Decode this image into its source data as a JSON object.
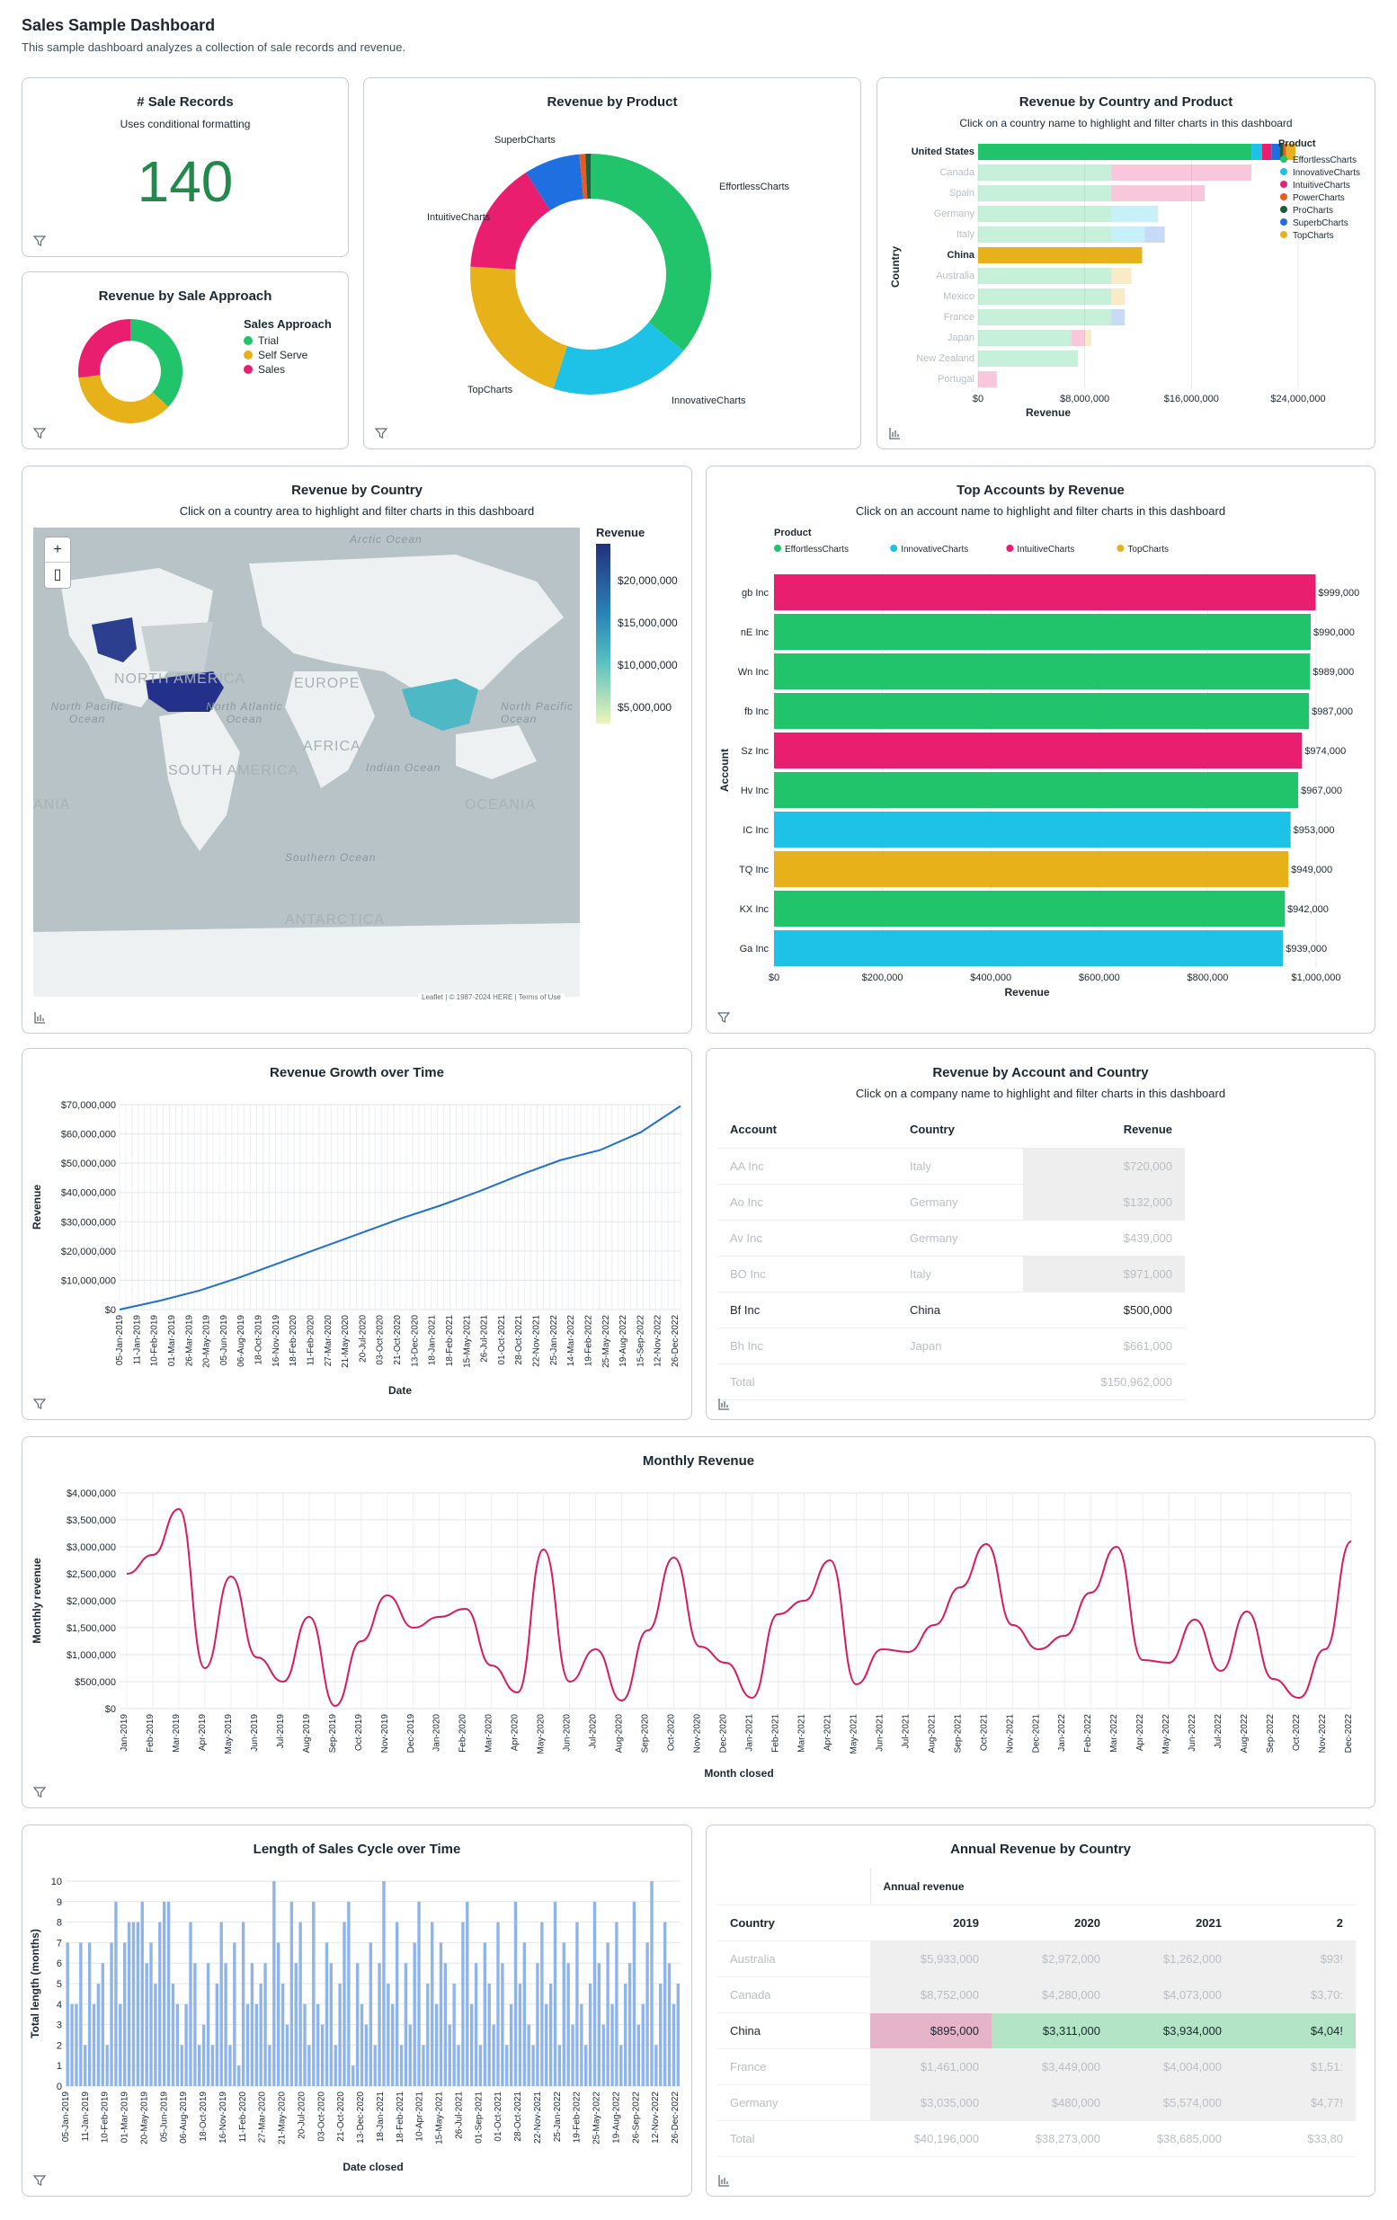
{
  "header": {
    "title": "Sales Sample Dashboard",
    "subtitle": "This sample dashboard analyzes a collection of sale records and revenue."
  },
  "sale_records": {
    "title": "# Sale Records",
    "subtitle": "Uses conditional formatting",
    "value": "140"
  },
  "sale_approach": {
    "title": "Revenue by Sale Approach",
    "legend_title": "Sales Approach",
    "items": [
      {
        "label": "Trial",
        "color": "#21c36b"
      },
      {
        "label": "Self Serve",
        "color": "#e7b119"
      },
      {
        "label": "Sales",
        "color": "#e91e6e"
      }
    ],
    "chart_data": {
      "type": "pie",
      "categories": [
        "Trial",
        "Self Serve",
        "Sales"
      ],
      "values": [
        37,
        36,
        27
      ]
    }
  },
  "rev_product": {
    "title": "Revenue by Product",
    "chart_data": {
      "type": "pie",
      "categories": [
        "EffortlessCharts",
        "InnovativeCharts",
        "TopCharts",
        "IntuitiveCharts",
        "SuperbCharts",
        "PowerCharts",
        "ProCharts"
      ],
      "values": [
        36,
        19,
        21,
        15,
        7.5,
        0.8,
        0.7
      ],
      "colors": [
        "#21c36b",
        "#1ec2e6",
        "#e7b119",
        "#e91e6e",
        "#1f6fe0",
        "#ea5a20",
        "#1b5e3a"
      ]
    }
  },
  "rev_country_product": {
    "title": "Revenue by Country and Product",
    "subtitle": "Click on a country name to highlight and filter charts in this dashboard",
    "ylabel": "Country",
    "xlabel": "Revenue",
    "legend_title": "Product",
    "legend": [
      {
        "label": "EffortlessCharts",
        "color": "#21c36b"
      },
      {
        "label": "InnovativeCharts",
        "color": "#1ec2e6"
      },
      {
        "label": "IntuitiveCharts",
        "color": "#e91e6e"
      },
      {
        "label": "PowerCharts",
        "color": "#ea5a20"
      },
      {
        "label": "ProCharts",
        "color": "#1b5e3a"
      },
      {
        "label": "SuperbCharts",
        "color": "#1f6fe0"
      },
      {
        "label": "TopCharts",
        "color": "#e7b119"
      }
    ],
    "chart_data": {
      "type": "bar",
      "categories": [
        "United States",
        "Canada",
        "Spain",
        "Germany",
        "Italy",
        "China",
        "Australia",
        "Mexico",
        "France",
        "Japan",
        "New Zealand",
        "Portugal"
      ],
      "highlighted": [
        "United States",
        "China"
      ],
      "xticks": [
        "$0",
        "$8,000,000",
        "$16,000,000",
        "$24,000,000"
      ],
      "xlim": [
        0,
        24000000
      ],
      "series": [
        {
          "name": "EffortlessCharts",
          "values": [
            20500000,
            10000000,
            10000000,
            10000000,
            10000000,
            0,
            10000000,
            10000000,
            10000000,
            7000000,
            7500000,
            0
          ]
        },
        {
          "name": "InnovativeCharts",
          "values": [
            800000,
            0,
            0,
            3500000,
            2500000,
            0,
            0,
            0,
            0,
            0,
            0,
            0
          ]
        },
        {
          "name": "IntuitiveCharts",
          "values": [
            700000,
            10500000,
            7000000,
            0,
            0,
            0,
            0,
            0,
            0,
            1000000,
            0,
            1400000
          ]
        },
        {
          "name": "SuperbCharts",
          "values": [
            600000,
            0,
            0,
            0,
            1500000,
            0,
            0,
            0,
            1000000,
            0,
            0,
            0
          ]
        },
        {
          "name": "ProCharts",
          "values": [
            300000,
            0,
            0,
            0,
            0,
            0,
            0,
            0,
            0,
            0,
            0,
            0
          ]
        },
        {
          "name": "PowerCharts",
          "values": [
            200000,
            0,
            0,
            0,
            0,
            0,
            0,
            0,
            0,
            0,
            0,
            0
          ]
        },
        {
          "name": "TopCharts",
          "values": [
            700000,
            0,
            0,
            0,
            0,
            12300000,
            1500000,
            1000000,
            0,
            500000,
            0,
            0
          ]
        }
      ]
    }
  },
  "rev_country": {
    "title": "Revenue by Country",
    "subtitle": "Click on a country area to highlight and filter charts in this dashboard",
    "legend_title": "Revenue",
    "legend_ticks": [
      "$20,000,000",
      "$15,000,000",
      "$10,000,000",
      "$5,000,000"
    ],
    "zoom_in": "+",
    "oceans": [
      "Arctic Ocean",
      "North Pacific Ocean",
      "North Atlantic Ocean",
      "Indian Ocean",
      "North Pacific Ocean",
      "Southern Ocean"
    ],
    "continents": [
      "NORTH AMERICA",
      "EUROPE",
      "AFRICA",
      "SOUTH AMERICA",
      "OCEANIA",
      "ANTARCTICA",
      "ANIA"
    ],
    "attribution": "Leaflet | © 1987-2024 HERE | Terms of Use"
  },
  "top_accounts": {
    "title": "Top Accounts by Revenue",
    "subtitle": "Click on an account name to highlight and filter charts in this dashboard",
    "legend_title": "Product",
    "ylabel": "Account",
    "xlabel": "Revenue",
    "legend": [
      {
        "label": "EffortlessCharts",
        "color": "#21c36b"
      },
      {
        "label": "InnovativeCharts",
        "color": "#1ec2e6"
      },
      {
        "label": "IntuitiveCharts",
        "color": "#e91e6e"
      },
      {
        "label": "TopCharts",
        "color": "#e7b119"
      }
    ],
    "chart_data": {
      "type": "bar",
      "categories": [
        "gb Inc",
        "nE Inc",
        "Wn Inc",
        "fb Inc",
        "Sz Inc",
        "Hv Inc",
        "IC Inc",
        "TQ Inc",
        "KX Inc",
        "Ga Inc"
      ],
      "values": [
        999000,
        990000,
        989000,
        987000,
        974000,
        967000,
        953000,
        949000,
        942000,
        939000
      ],
      "labels": [
        "$999,000",
        "$990,000",
        "$989,000",
        "$987,000",
        "$974,000",
        "$967,000",
        "$953,000",
        "$949,000",
        "$942,000",
        "$939,000"
      ],
      "product": [
        "IntuitiveCharts",
        "EffortlessCharts",
        "EffortlessCharts",
        "EffortlessCharts",
        "IntuitiveCharts",
        "EffortlessCharts",
        "InnovativeCharts",
        "TopCharts",
        "EffortlessCharts",
        "InnovativeCharts"
      ],
      "xticks": [
        "$0",
        "$200,000",
        "$400,000",
        "$600,000",
        "$800,000",
        "$1,000,000"
      ],
      "xlim": [
        0,
        1000000
      ]
    }
  },
  "growth": {
    "title": "Revenue Growth over Time",
    "ylabel": "Revenue",
    "xlabel": "Date",
    "chart_data": {
      "type": "line",
      "yticks": [
        "$70,000,000",
        "$60,000,000",
        "$50,000,000",
        "$40,000,000",
        "$30,000,000",
        "$20,000,000",
        "$10,000,000",
        "$0"
      ],
      "ylim": [
        0,
        70000000
      ],
      "xticks": [
        "05-Jan-2019",
        "11-Jan-2019",
        "10-Feb-2019",
        "01-Mar-2019",
        "26-Mar-2019",
        "20-May-2019",
        "05-Jun-2019",
        "06-Aug-2019",
        "18-Oct-2019",
        "16-Nov-2019",
        "18-Feb-2020",
        "11-Feb-2020",
        "27-Mar-2020",
        "21-May-2020",
        "20-Jul-2020",
        "03-Oct-2020",
        "21-Oct-2020",
        "13-Dec-2020",
        "18-Jan-2021",
        "18-Feb-2021",
        "15-May-2021",
        "26-Jul-2021",
        "01-Oct-2021",
        "28-Oct-2021",
        "22-Nov-2021",
        "25-Jan-2022",
        "14-Mar-2022",
        "19-Feb-2022",
        "25-May-2022",
        "19-Aug-2022",
        "15-Sep-2022",
        "12-Nov-2022",
        "26-Dec-2022"
      ],
      "x": [
        0,
        10,
        20,
        30,
        40,
        50,
        60,
        70,
        80,
        90,
        100,
        110,
        120,
        130,
        140
      ],
      "values": [
        0,
        3000000,
        6500000,
        11000000,
        16000000,
        21000000,
        26000000,
        31000000,
        35500000,
        40500000,
        46000000,
        51000000,
        54500000,
        60500000,
        69500000
      ]
    }
  },
  "acct_country": {
    "title": "Revenue by Account and Country",
    "subtitle": "Click on a company name to highlight and filter charts in this dashboard",
    "columns": [
      "Account",
      "Country",
      "Revenue"
    ],
    "rows": [
      [
        "AA Inc",
        "Italy",
        "$720,000"
      ],
      [
        "Ao Inc",
        "Germany",
        "$132,000"
      ],
      [
        "Av Inc",
        "Germany",
        "$439,000"
      ],
      [
        "BO Inc",
        "Italy",
        "$971,000"
      ],
      [
        "Bf Inc",
        "China",
        "$500,000"
      ],
      [
        "Bh Inc",
        "Japan",
        "$661,000"
      ]
    ],
    "total_label": "Total",
    "total": "$150,962,000"
  },
  "monthly": {
    "title": "Monthly Revenue",
    "ylabel": "Monthly revenue",
    "xlabel": "Month closed",
    "chart_data": {
      "type": "line",
      "yticks": [
        "$4,000,000",
        "$3,500,000",
        "$3,000,000",
        "$2,500,000",
        "$2,000,000",
        "$1,500,000",
        "$1,000,000",
        "$500,000",
        "$0"
      ],
      "ylim": [
        0,
        4000000
      ],
      "categories": [
        "Jan-2019",
        "Feb-2019",
        "Mar-2019",
        "Apr-2019",
        "May-2019",
        "Jun-2019",
        "Jul-2019",
        "Aug-2019",
        "Sep-2019",
        "Oct-2019",
        "Nov-2019",
        "Dec-2019",
        "Jan-2020",
        "Feb-2020",
        "Mar-2020",
        "Apr-2020",
        "May-2020",
        "Jun-2020",
        "Jul-2020",
        "Aug-2020",
        "Sep-2020",
        "Oct-2020",
        "Nov-2020",
        "Dec-2020",
        "Jan-2021",
        "Feb-2021",
        "Mar-2021",
        "Apr-2021",
        "May-2021",
        "Jun-2021",
        "Jul-2021",
        "Aug-2021",
        "Sep-2021",
        "Oct-2021",
        "Nov-2021",
        "Dec-2021",
        "Jan-2022",
        "Feb-2022",
        "Mar-2022",
        "Apr-2022",
        "May-2022",
        "Jun-2022",
        "Jul-2022",
        "Aug-2022",
        "Sep-2022",
        "Oct-2022",
        "Nov-2022",
        "Dec-2022"
      ],
      "values": [
        2500000,
        2850000,
        3700000,
        750000,
        2450000,
        950000,
        500000,
        1700000,
        50000,
        1250000,
        2100000,
        1500000,
        1700000,
        1850000,
        800000,
        300000,
        2950000,
        500000,
        1100000,
        150000,
        1450000,
        2800000,
        1150000,
        850000,
        200000,
        1750000,
        2000000,
        2750000,
        450000,
        1100000,
        1050000,
        1550000,
        2250000,
        3050000,
        1550000,
        1100000,
        1350000,
        2150000,
        3000000,
        900000,
        850000,
        1650000,
        700000,
        1800000,
        550000,
        200000,
        1100000,
        3100000
      ]
    }
  },
  "cycle": {
    "title": "Length of Sales Cycle over Time",
    "ylabel": "Total length (months)",
    "xlabel": "Date closed",
    "chart_data": {
      "type": "bar",
      "yticks": [
        "10",
        "9",
        "8",
        "7",
        "6",
        "5",
        "4",
        "3",
        "2",
        "1",
        "0"
      ],
      "ylim": [
        0,
        10
      ],
      "xticks": [
        "05-Jan-2019",
        "11-Jan-2019",
        "10-Feb-2019",
        "01-Mar-2019",
        "20-May-2019",
        "05-Jun-2019",
        "06-Aug-2019",
        "18-Oct-2019",
        "16-Nov-2019",
        "11-Feb-2020",
        "27-Mar-2020",
        "21-May-2020",
        "20-Jul-2020",
        "03-Oct-2020",
        "21-Oct-2020",
        "13-Dec-2020",
        "18-Jan-2021",
        "18-Feb-2021",
        "10-Apr-2021",
        "15-May-2021",
        "26-Jul-2021",
        "01-Sep-2021",
        "01-Oct-2021",
        "28-Oct-2021",
        "22-Nov-2021",
        "25-Jan-2022",
        "19-Feb-2022",
        "25-May-2022",
        "19-Aug-2022",
        "26-Sep-2022",
        "12-Nov-2022",
        "26-Dec-2022"
      ],
      "values": [
        7,
        4,
        4,
        7,
        2,
        7,
        4,
        5,
        6,
        2,
        7,
        9,
        4,
        7,
        8,
        8,
        8,
        9,
        6,
        7,
        5,
        8,
        9,
        9,
        5,
        4,
        2,
        4,
        8,
        6,
        2,
        3,
        6,
        2,
        5,
        8,
        6,
        2,
        7,
        1,
        8,
        4,
        6,
        4,
        5,
        6,
        2,
        10,
        7,
        5,
        3,
        9,
        6,
        8,
        4,
        2,
        9,
        4,
        3,
        7,
        6,
        2,
        5,
        8,
        9,
        1,
        6,
        4,
        3,
        7,
        2,
        6,
        10,
        5,
        4,
        8,
        2,
        6,
        3,
        7,
        9,
        2,
        5,
        8,
        4,
        7,
        6,
        3,
        5,
        2,
        8,
        9,
        4,
        6,
        2,
        7,
        5,
        3,
        8,
        6,
        2,
        4,
        9,
        5,
        7,
        3,
        2,
        6,
        8,
        4,
        5,
        9,
        2,
        7,
        6,
        3,
        8,
        4,
        2,
        5,
        9,
        6,
        3,
        7,
        4,
        8,
        2,
        5,
        6,
        9,
        3,
        4,
        7,
        10,
        2,
        5,
        8,
        6,
        4,
        5
      ]
    }
  },
  "annual": {
    "title": "Annual Revenue by Country",
    "group_header": "Annual revenue",
    "columns": [
      "Country",
      "2019",
      "2020",
      "2021",
      "2"
    ],
    "rows": [
      [
        "Australia",
        "$5,933,000",
        "$2,972,000",
        "$1,262,000",
        "$93!"
      ],
      [
        "Canada",
        "$8,752,000",
        "$4,280,000",
        "$4,073,000",
        "$3,70:"
      ],
      [
        "China",
        "$895,000",
        "$3,311,000",
        "$3,934,000",
        "$4,04!"
      ],
      [
        "France",
        "$1,461,000",
        "$3,449,000",
        "$4,004,000",
        "$1,51:"
      ],
      [
        "Germany",
        "$3,035,000",
        "$480,000",
        "$5,574,000",
        "$4,77!"
      ]
    ],
    "total_label": "Total",
    "totals": [
      "$40,196,000",
      "$38,273,000",
      "$38,685,000",
      "$33,80"
    ]
  }
}
